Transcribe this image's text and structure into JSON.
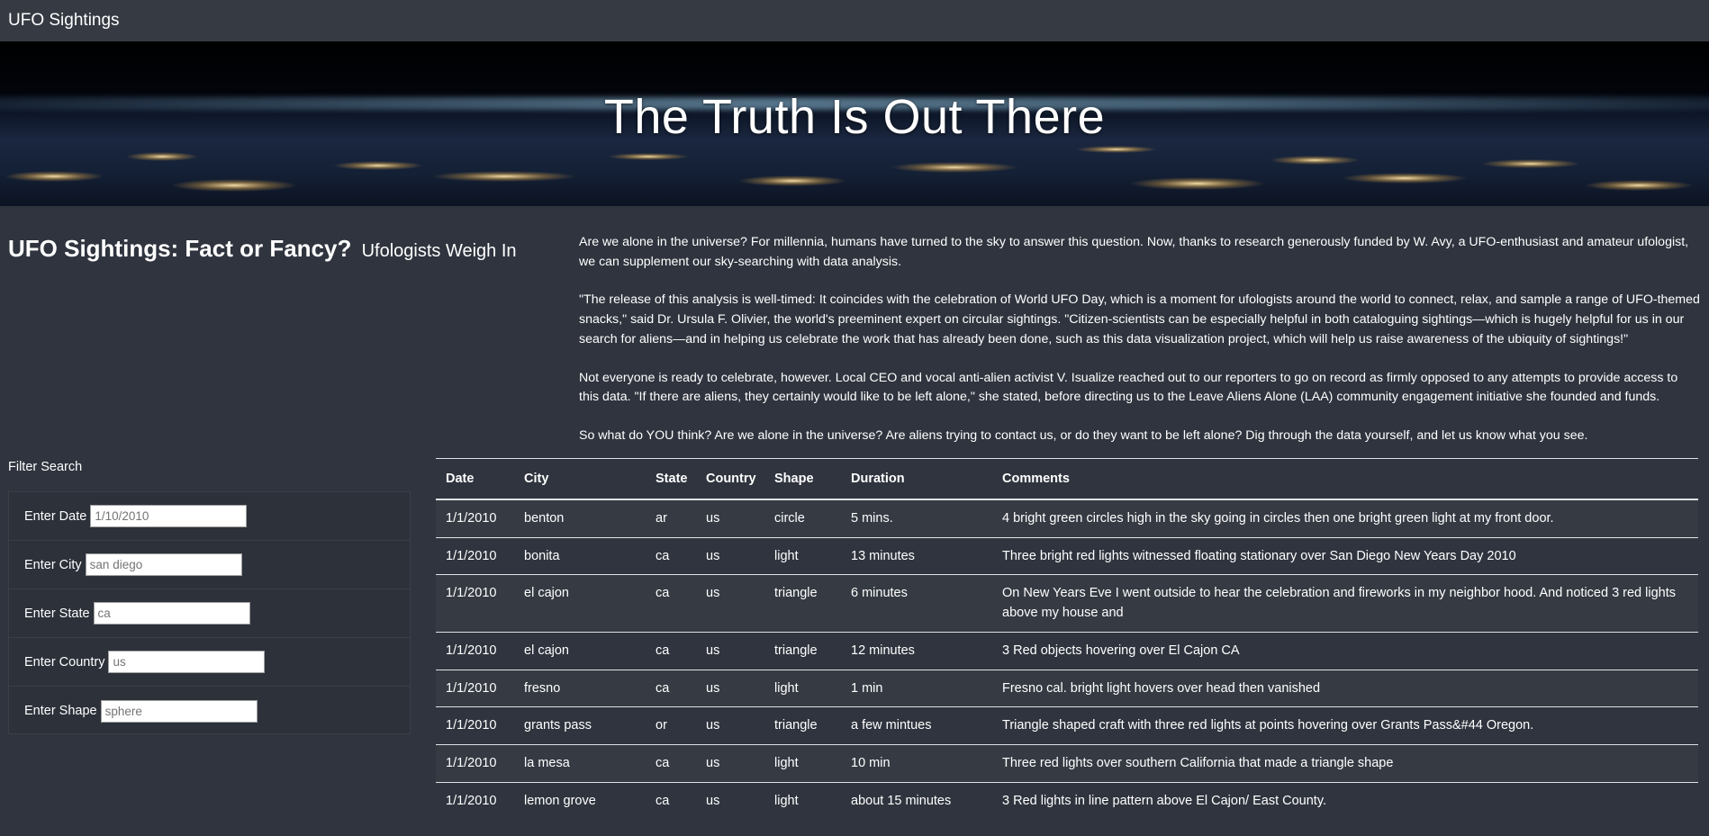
{
  "navbar": {
    "brand": "UFO Sightings"
  },
  "hero": {
    "title": "The Truth Is Out There"
  },
  "intro": {
    "heading": "UFO Sightings: Fact or Fancy?",
    "subheading": "Ufologists Weigh In",
    "paragraphs": [
      "Are we alone in the universe? For millennia, humans have turned to the sky to answer this question. Now, thanks to research generously funded by W. Avy, a UFO-enthusiast and amateur ufologist, we can supplement our sky-searching with data analysis.",
      "\"The release of this analysis is well-timed: It coincides with the celebration of World UFO Day, which is a moment for ufologists around the world to connect, relax, and sample a range of UFO-themed snacks,\" said Dr. Ursula F. Olivier, the world's preeminent expert on circular sightings. \"Citizen-scientists can be especially helpful in both cataloguing sightings—which is hugely helpful for us in our search for aliens—and in helping us celebrate the work that has already been done, such as this data visualization project, which will help us raise awareness of the ubiquity of sightings!\"",
      "Not everyone is ready to celebrate, however. Local CEO and vocal anti-alien activist V. Isualize reached out to our reporters to go on record as firmly opposed to any attempts to provide access to this data. \"If there are aliens, they certainly would like to be left alone,\" she stated, before directing us to the Leave Aliens Alone (LAA) community engagement initiative she founded and funds.",
      "So what do YOU think? Are we alone in the universe? Are aliens trying to contact us, or do they want to be left alone? Dig through the data yourself, and let us know what you see."
    ]
  },
  "filters": {
    "title": "Filter Search",
    "items": [
      {
        "label": "Enter Date",
        "placeholder": "1/10/2010"
      },
      {
        "label": "Enter City",
        "placeholder": "san diego"
      },
      {
        "label": "Enter State",
        "placeholder": "ca"
      },
      {
        "label": "Enter Country",
        "placeholder": "us"
      },
      {
        "label": "Enter Shape",
        "placeholder": "sphere"
      }
    ]
  },
  "table": {
    "headers": [
      "Date",
      "City",
      "State",
      "Country",
      "Shape",
      "Duration",
      "Comments"
    ],
    "rows": [
      [
        "1/1/2010",
        "benton",
        "ar",
        "us",
        "circle",
        "5 mins.",
        "4 bright green circles high in the sky going in circles then one bright green light at my front door."
      ],
      [
        "1/1/2010",
        "bonita",
        "ca",
        "us",
        "light",
        "13 minutes",
        "Three bright red lights witnessed floating stationary over San Diego New Years Day 2010"
      ],
      [
        "1/1/2010",
        "el cajon",
        "ca",
        "us",
        "triangle",
        "6 minutes",
        "On New Years Eve I went outside to hear the celebration and fireworks in my neighbor hood. And noticed 3 red lights above my house and"
      ],
      [
        "1/1/2010",
        "el cajon",
        "ca",
        "us",
        "triangle",
        "12 minutes",
        "3 Red objects hovering over El Cajon CA"
      ],
      [
        "1/1/2010",
        "fresno",
        "ca",
        "us",
        "light",
        "1 min",
        "Fresno cal. bright light hovers over head then vanished"
      ],
      [
        "1/1/2010",
        "grants pass",
        "or",
        "us",
        "triangle",
        "a few mintues",
        "Triangle shaped craft with three red lights at points hovering over Grants Pass&#44 Oregon."
      ],
      [
        "1/1/2010",
        "la mesa",
        "ca",
        "us",
        "light",
        "10 min",
        "Three red lights over southern California that made a triangle shape"
      ],
      [
        "1/1/2010",
        "lemon grove",
        "ca",
        "us",
        "light",
        "about 15 minutes",
        "3 Red lights in line pattern above El Cajon/ East County."
      ]
    ]
  }
}
